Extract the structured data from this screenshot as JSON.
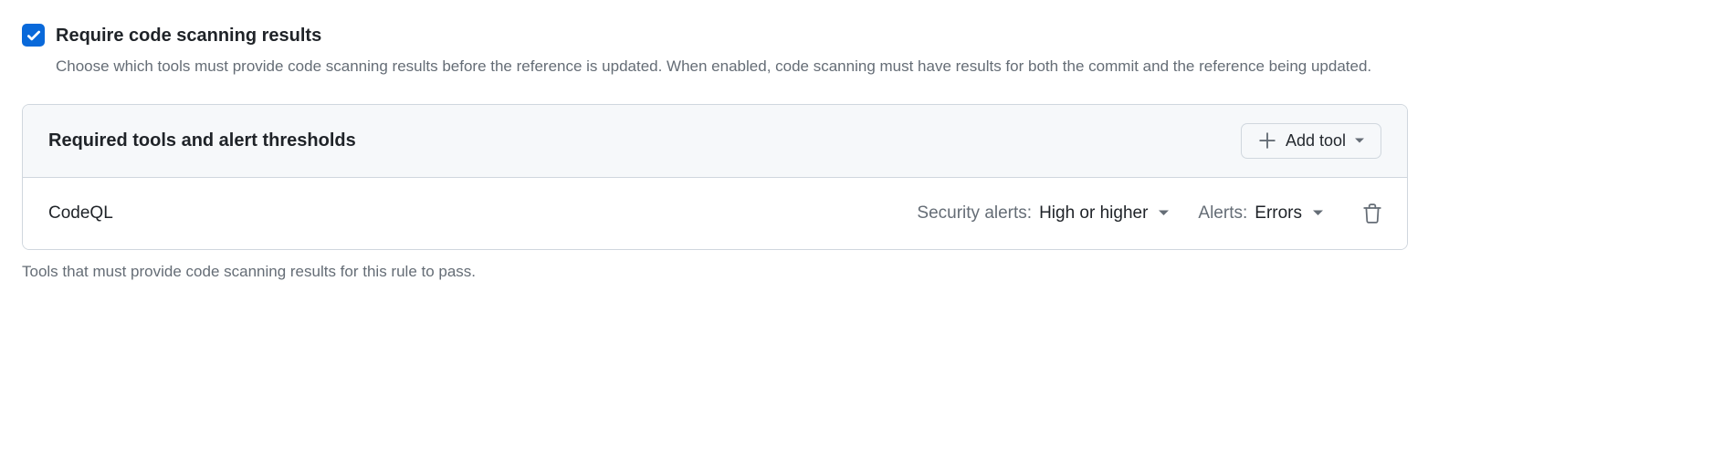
{
  "rule": {
    "title": "Require code scanning results",
    "description": "Choose which tools must provide code scanning results before the reference is updated. When enabled, code scanning must have results for both the commit and the reference being updated."
  },
  "panel": {
    "title": "Required tools and alert thresholds",
    "add_button": "Add tool"
  },
  "tools": [
    {
      "name": "CodeQL",
      "security_alerts_label": "Security alerts:",
      "security_alerts_value": "High or higher",
      "alerts_label": "Alerts:",
      "alerts_value": "Errors"
    }
  ],
  "footer": "Tools that must provide code scanning results for this rule to pass."
}
